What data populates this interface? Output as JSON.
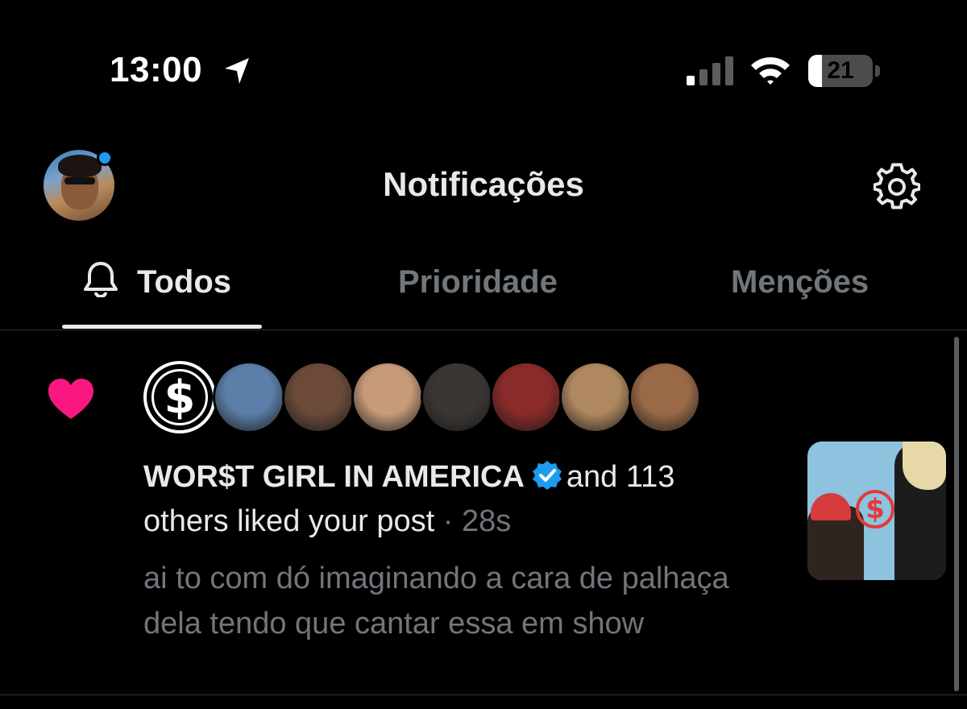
{
  "status_bar": {
    "time": "13:00",
    "battery": "21",
    "battery_level": 0.21
  },
  "header": {
    "title": "Notificações"
  },
  "tabs": [
    {
      "label": "Todos",
      "active": true
    },
    {
      "label": "Prioridade",
      "active": false
    },
    {
      "label": "Menções",
      "active": false
    }
  ],
  "notification": {
    "name": "WOR$T GIRL IN AMERICA",
    "and_text": "and 113",
    "action": "others liked your post",
    "separator": "·",
    "time": "28s",
    "preview": "ai to com dó imaginando a cara de palhaça dela tendo que cantar essa em show",
    "avatar_colors": [
      "#5b7fa8",
      "#6b4a3a",
      "#c79a7a",
      "#3a3634",
      "#8a2a2a",
      "#b08860",
      "#9a6a48"
    ]
  },
  "colors": {
    "accent": "#1d9bf0",
    "like": "#f91880",
    "background": "#000000",
    "muted": "#71767b"
  }
}
